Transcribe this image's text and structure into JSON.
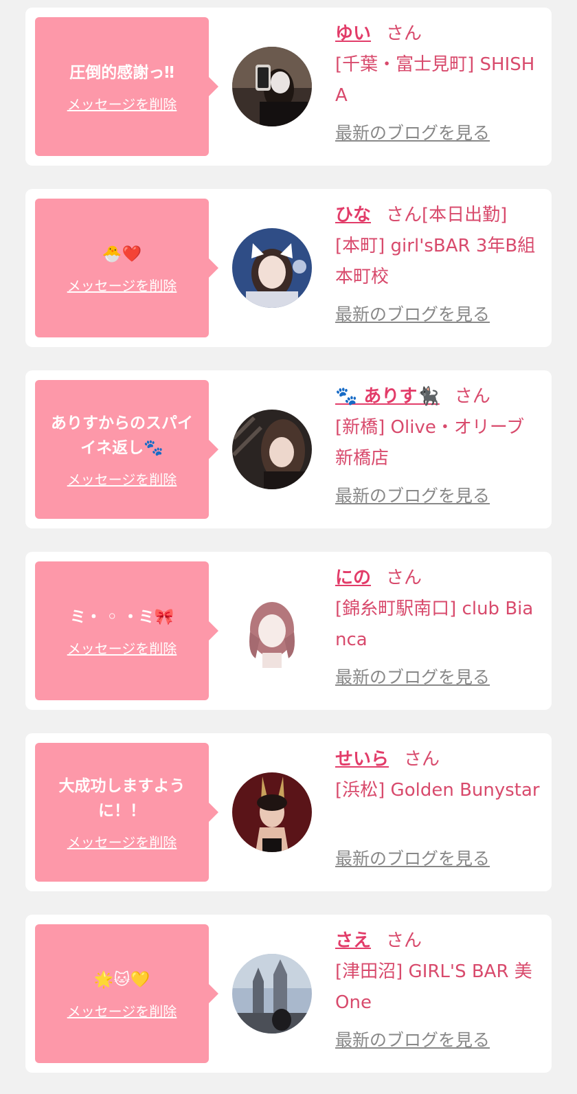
{
  "cards": [
    {
      "message": "圧倒的感謝っ‼",
      "delete_label": "メッセージを削除",
      "name": "ゆい",
      "honorific": "さん",
      "shop": "[千葉・富士見町] SHISHA",
      "blog_label": "最新のブログを見る"
    },
    {
      "message": "🐣❤️",
      "delete_label": "メッセージを削除",
      "name": "ひな",
      "honorific": "さん[本日出勤]",
      "shop": "[本町] girl'sBAR 3年B組 本町校",
      "blog_label": "最新のブログを見る"
    },
    {
      "message": "ありすからのスパイイネ返し🐾",
      "delete_label": "メッセージを削除",
      "name": "🐾 ありす🐈‍⬛",
      "honorific": "さん",
      "shop": "[新橋] Olive・オリーブ新橋店",
      "blog_label": "最新のブログを見る"
    },
    {
      "message": "ミ・ ◦ ・ミ🎀",
      "delete_label": "メッセージを削除",
      "name": "にの",
      "honorific": "さん",
      "shop": "[錦糸町駅南口] club Bianca",
      "blog_label": "最新のブログを見る"
    },
    {
      "message": "大成功しますように！！",
      "delete_label": "メッセージを削除",
      "name": "せいら",
      "honorific": "さん",
      "shop": "[浜松] Golden Bunystar",
      "blog_label": "最新のブログを見る"
    },
    {
      "message": "🌟🐱💛",
      "delete_label": "メッセージを削除",
      "name": "さえ",
      "honorific": "さん",
      "shop": "[津田沼] GIRL'S BAR 美One",
      "blog_label": "最新のブログを見る"
    }
  ],
  "colors": {
    "background": "#f1f1f1",
    "bubble": "#fd98a9",
    "name": "#e23c69",
    "shop_text": "#d84a6c",
    "blog_link": "#888888"
  }
}
